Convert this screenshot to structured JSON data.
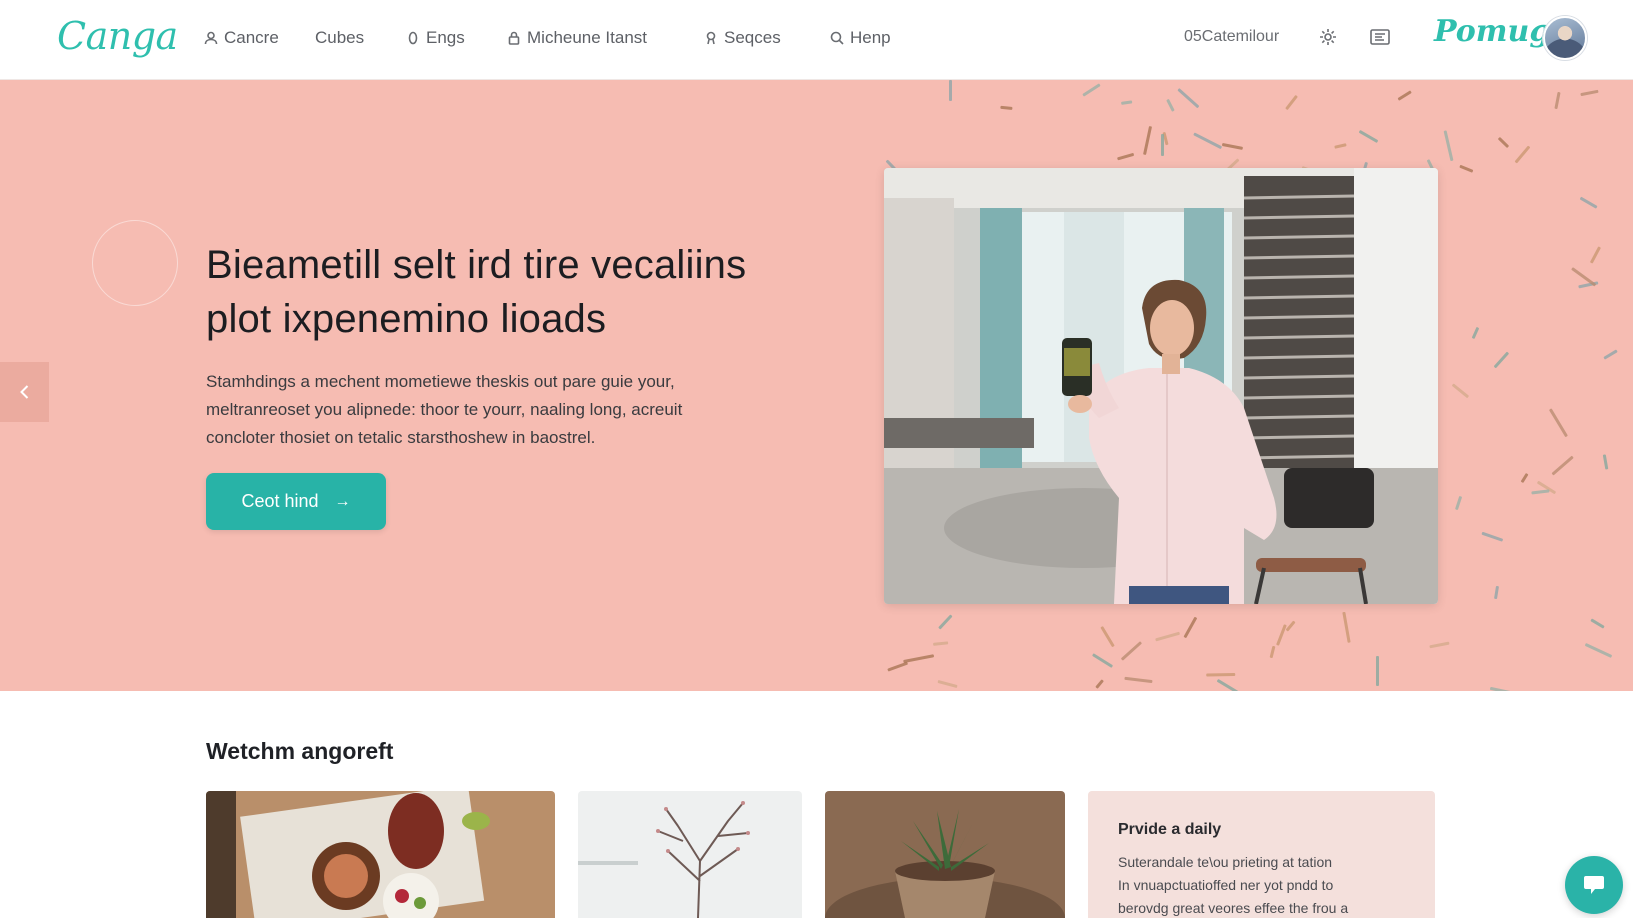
{
  "header": {
    "logo": "Canga",
    "nav": [
      {
        "label": "Cancre",
        "icon": "user-icon"
      },
      {
        "label": "Cubes",
        "icon": ""
      },
      {
        "label": "Engs",
        "icon": "zero-icon"
      },
      {
        "label": "Micheune Itanst",
        "icon": "lock-icon"
      },
      {
        "label": "Seqces",
        "icon": "pin-icon"
      },
      {
        "label": "Henp",
        "icon": "search-icon"
      }
    ],
    "right_text": "05Catemilour",
    "settings_icon": "settings-icon",
    "list_icon": "list-icon",
    "brand": "Pomug",
    "avatar_icon": "avatar"
  },
  "hero": {
    "title_line1": "Bieametill selt ird tire vecaliins",
    "title_line2": "plot ixpenemino lioads",
    "desc_line1": "Stamhdings a mechent mometiewe theskis out pare guie your,",
    "desc_line2": "meltranreoset you alipnede: thoor te yourr, naaling long, acreuit",
    "desc_line3": "concloter thosiet on tetalic starsthoshew in baostrel.",
    "cta_label": "Ceot hind",
    "cta_arrow": "→",
    "background_color": "#f6bcb2",
    "accent_color": "#28b3a7"
  },
  "section": {
    "title": "Wetchm angoreft",
    "cards": [
      {
        "type": "image",
        "image": "food-plate"
      },
      {
        "type": "image",
        "image": "bare-tree-branches"
      },
      {
        "type": "image",
        "image": "succulent-pot"
      },
      {
        "type": "text",
        "title": "Prvide a daily",
        "body_line1": "Suterandale te\\ou prieting at tation",
        "body_line2": "In vnuapctuatioffed ner yot pndd to",
        "body_line3": "berovdg great veores effee the frou a"
      }
    ]
  },
  "chat": {
    "icon": "chat-icon"
  }
}
